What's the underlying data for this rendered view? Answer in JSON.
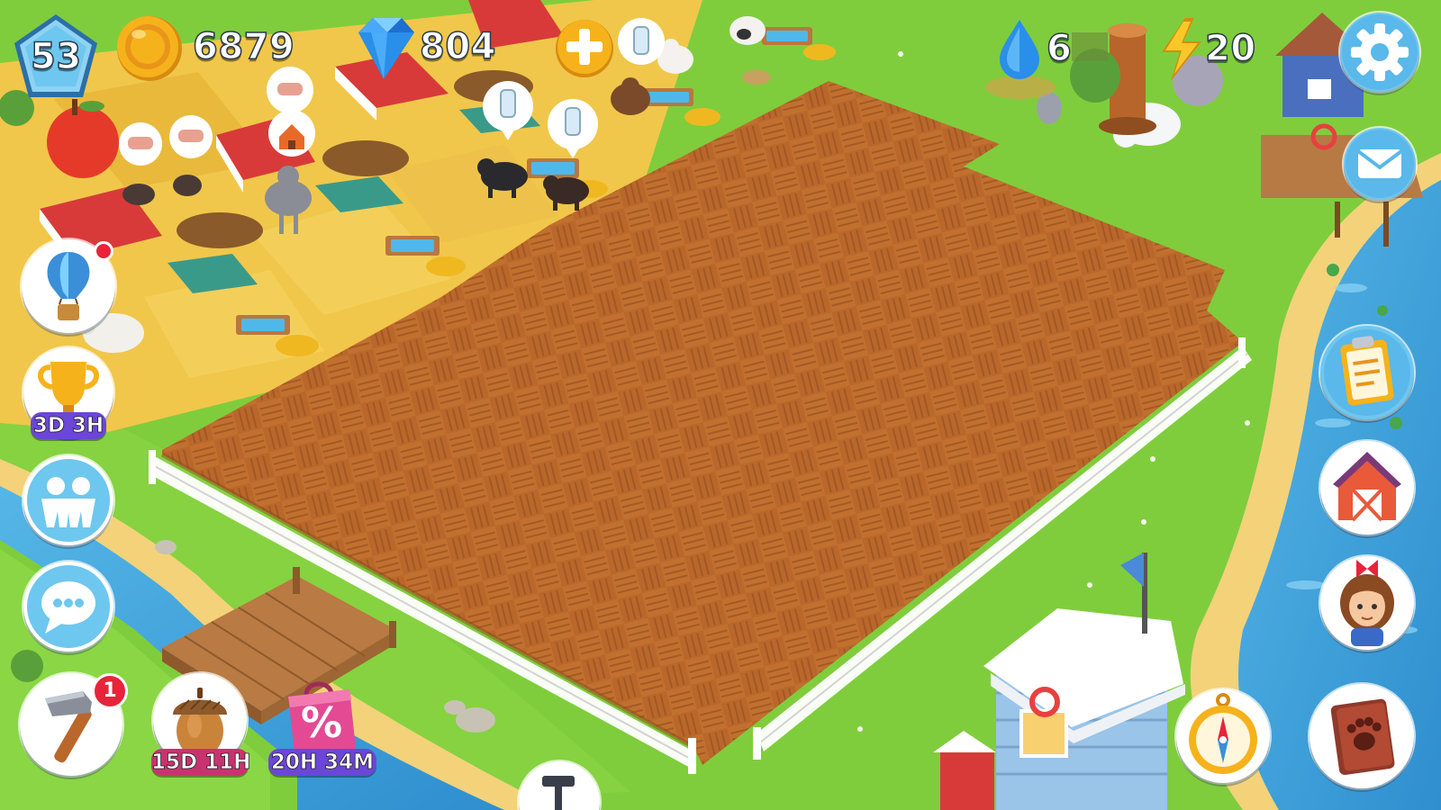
{
  "hud": {
    "level": "53",
    "coins": "6879",
    "gems": "804",
    "water": "6",
    "energy": "20"
  },
  "left_menu": {
    "trophy_timer": "3D 3H",
    "acorn_timer": "15D 11H",
    "sale_timer": "20H 34M",
    "sale_symbol": "%",
    "build_badge": "1"
  },
  "colors": {
    "grass": "#7fcd3c",
    "soil": "#b8662a",
    "water": "#3a9fd8",
    "sand": "#f3d27a",
    "hud_blue": "#6ec7ef",
    "coin_gold": "#f6b21b",
    "gem_blue": "#2a8fe8",
    "timer_purple": "#6b46d8",
    "sale_pink": "#e34a93",
    "acorn_timer_pink": "#c8336f",
    "badge_red": "#e8233a"
  },
  "icons": {
    "level": "level-badge-icon",
    "coin": "coin-icon",
    "gem": "gem-icon",
    "add": "add-currency-icon",
    "water": "water-drop-icon",
    "energy": "lightning-icon",
    "settings": "gear-icon",
    "mail": "mail-icon",
    "balloon": "hot-air-balloon-icon",
    "trophy": "trophy-icon",
    "friends": "friends-icon",
    "chat": "chat-icon",
    "build": "hammer-icon",
    "acorn": "acorn-icon",
    "sale": "sale-bag-icon",
    "tasks": "clipboard-icon",
    "barn": "barn-icon",
    "character": "farmer-girl-icon",
    "compass": "compass-icon",
    "album": "pet-book-icon"
  }
}
